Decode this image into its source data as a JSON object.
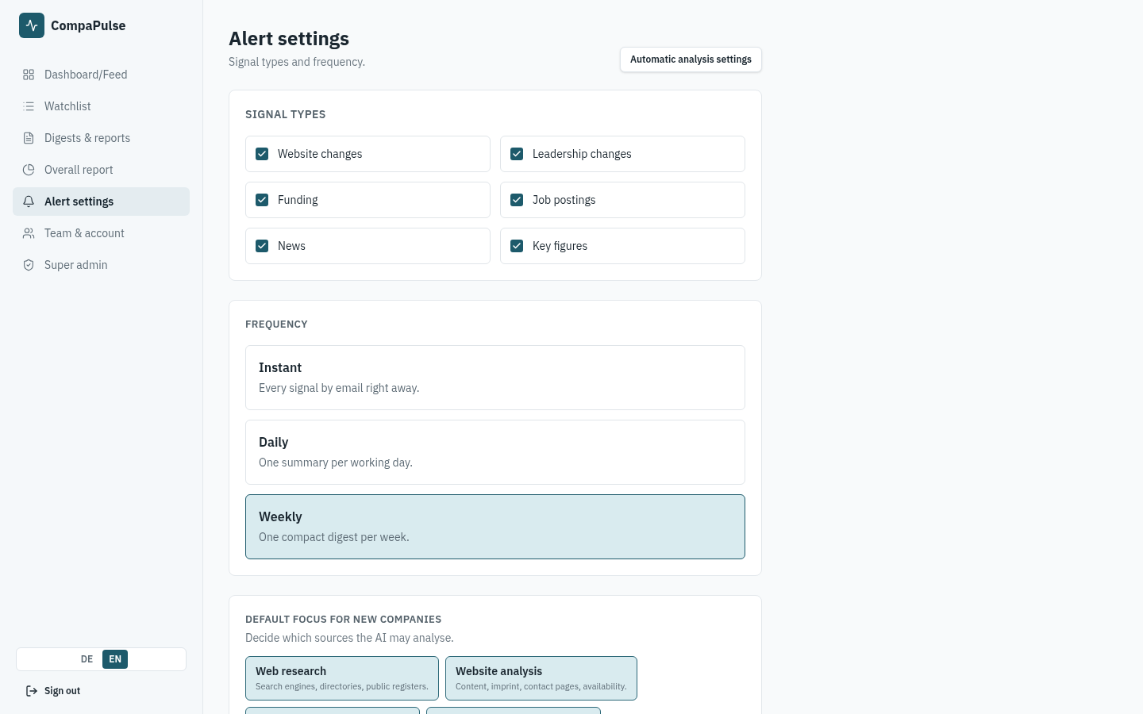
{
  "brand": {
    "name": "CompaPulse"
  },
  "sidebar": {
    "items": [
      {
        "label": "Dashboard/Feed",
        "kind": "grid",
        "selected": false
      },
      {
        "label": "Watchlist",
        "kind": "list",
        "selected": false
      },
      {
        "label": "Digests & reports",
        "kind": "file",
        "selected": false
      },
      {
        "label": "Overall report",
        "kind": "pie",
        "selected": false
      },
      {
        "label": "Alert settings",
        "kind": "bell",
        "selected": true
      },
      {
        "label": "Team & account",
        "kind": "users",
        "selected": false
      },
      {
        "label": "Super admin",
        "kind": "shield",
        "selected": false
      }
    ],
    "languages": [
      {
        "label": "DE",
        "selected": false
      },
      {
        "label": "EN",
        "selected": true
      }
    ],
    "sign_out": "Sign out"
  },
  "header": {
    "title": "Alert settings",
    "subtitle": "Signal types and frequency.",
    "button": "Automatic analysis settings"
  },
  "signal_types": {
    "heading": "SIGNAL TYPES",
    "items": [
      {
        "label": "Website changes",
        "checked": true
      },
      {
        "label": "Leadership changes",
        "checked": true
      },
      {
        "label": "Funding",
        "checked": true
      },
      {
        "label": "Job postings",
        "checked": true
      },
      {
        "label": "News",
        "checked": true
      },
      {
        "label": "Key figures",
        "checked": true
      }
    ]
  },
  "frequency": {
    "heading": "FREQUENCY",
    "options": [
      {
        "title": "Instant",
        "description": "Every signal by email right away.",
        "selected": false
      },
      {
        "title": "Daily",
        "description": "One summary per working day.",
        "selected": false
      },
      {
        "title": "Weekly",
        "description": "One compact digest per week.",
        "selected": true
      }
    ]
  },
  "default_focus": {
    "heading": "DEFAULT FOCUS FOR NEW COMPANIES",
    "description": "Decide which sources the AI may analyse.",
    "options": [
      {
        "title": "Web research",
        "description": "Search engines, directories, public registers.",
        "selected": true
      },
      {
        "title": "Website analysis",
        "description": "Content, imprint, contact pages, availability.",
        "selected": true
      },
      {
        "selected": true
      },
      {
        "selected": true
      }
    ]
  }
}
